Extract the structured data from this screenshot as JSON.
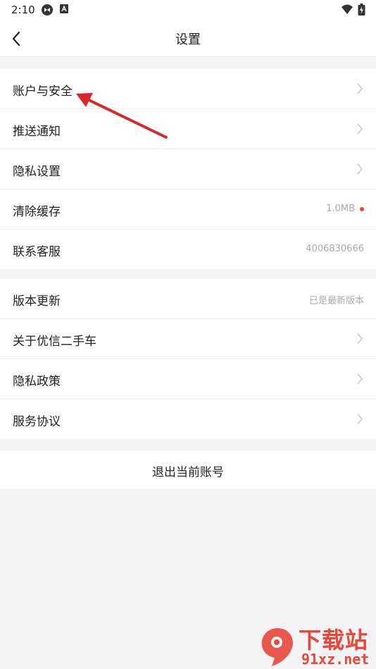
{
  "status_bar": {
    "time": "2:10"
  },
  "header": {
    "title": "设置"
  },
  "group1": {
    "items": [
      {
        "label": "账户与安全"
      },
      {
        "label": "推送通知"
      },
      {
        "label": "隐私设置"
      },
      {
        "label": "清除缓存",
        "value": "1.0MB"
      },
      {
        "label": "联系客服",
        "value": "4006830666"
      }
    ]
  },
  "group2": {
    "items": [
      {
        "label": "版本更新",
        "value": "已是最新版本"
      },
      {
        "label": "关于优信二手车"
      },
      {
        "label": "隐私政策"
      },
      {
        "label": "服务协议"
      }
    ]
  },
  "logout": {
    "label": "退出当前账号"
  },
  "watermark": {
    "line1": "下载站",
    "line2": "91xz.net"
  },
  "colors": {
    "accent_red": "#e8472c",
    "background": "#f4f4f4",
    "annotation_arrow": "#d9262b"
  }
}
